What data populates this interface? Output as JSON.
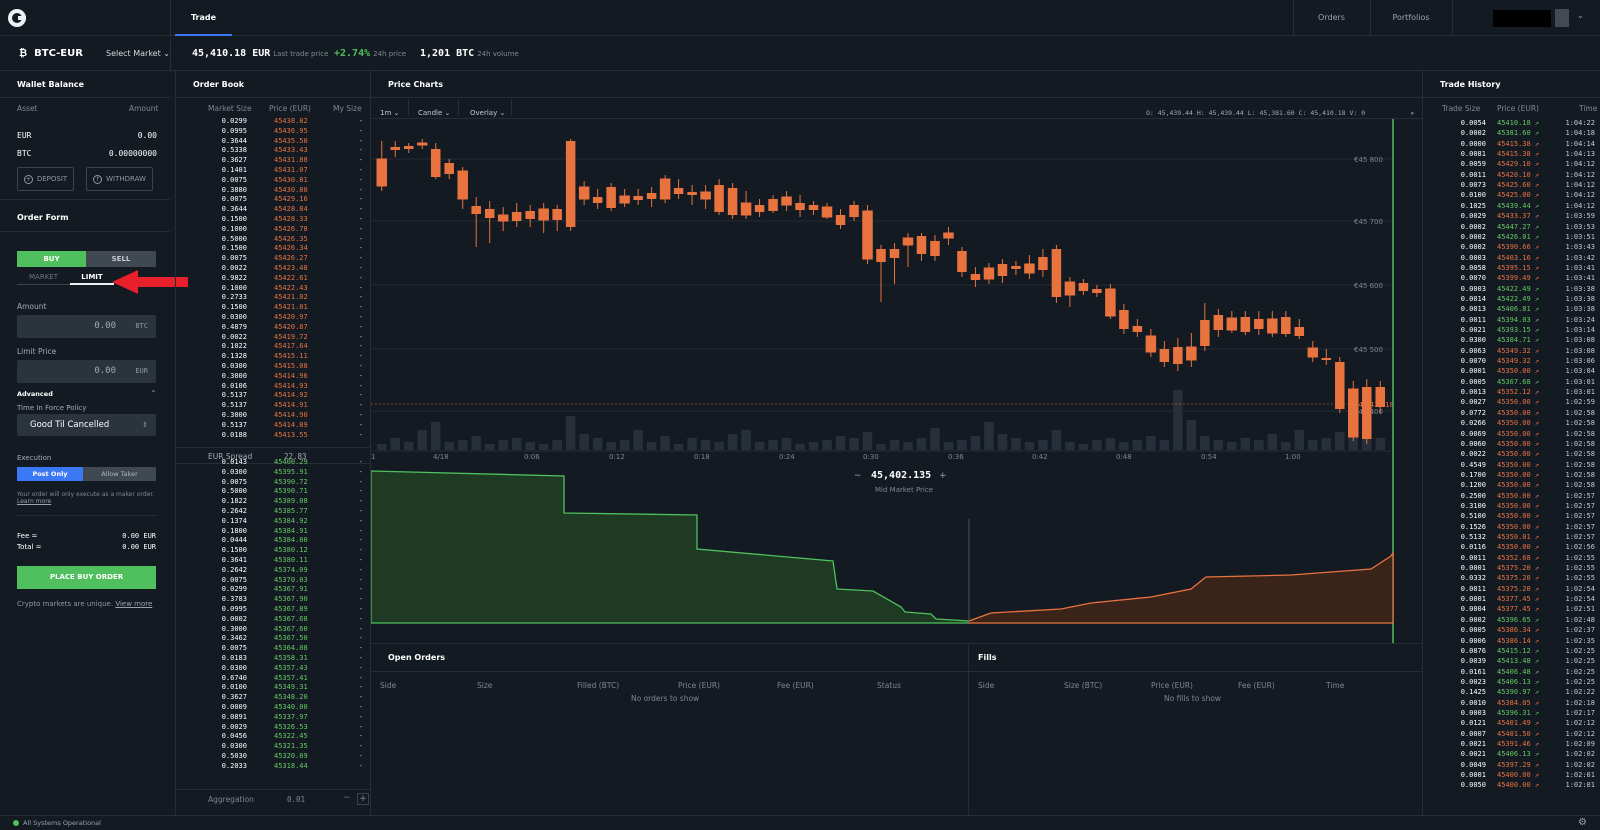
{
  "nav": {
    "tab": "Trade",
    "orders": "Orders",
    "portfolios": "Portfolios"
  },
  "market": {
    "pair": "BTC-EUR",
    "select": "Select Market",
    "last_price": "45,410.18 EUR",
    "last_price_label": "Last trade price",
    "change": "+2.74%",
    "change_label": "24h price",
    "volume": "1,201 BTC",
    "volume_label": "24h volume"
  },
  "wallet": {
    "title": "Wallet Balance",
    "asset_hdr": "Asset",
    "amount_hdr": "Amount",
    "rows": [
      {
        "asset": "EUR",
        "amount": "0.00"
      },
      {
        "asset": "BTC",
        "amount": "0.00000000"
      }
    ],
    "deposit": "DEPOSIT",
    "withdraw": "WITHDRAW"
  },
  "order_form": {
    "title": "Order Form",
    "buy": "BUY",
    "sell": "SELL",
    "market": "MARKET",
    "limit": "LIMIT",
    "amount_label": "Amount",
    "amount_value": "0.00",
    "amount_unit": "BTC",
    "limit_label": "Limit Price",
    "limit_value": "0.00",
    "limit_unit": "EUR",
    "advanced": "Advanced",
    "tif_label": "Time In Force Policy",
    "tif_value": "Good Til Cancelled",
    "execution_label": "Execution",
    "post_only": "Post Only",
    "allow_taker": "Allow Taker",
    "note": "Your order will only execute as a maker order.",
    "learn_more": "Learn more",
    "fee_label": "Fee =",
    "fee_value": "0.00 EUR",
    "total_label": "Total =",
    "total_value": "0.00 EUR",
    "place": "PLACE BUY ORDER",
    "unique": "Crypto markets are unique.",
    "view_more": "View more"
  },
  "order_book": {
    "title": "Order Book",
    "hdr_size": "Market Size",
    "hdr_price": "Price (EUR)",
    "hdr_my": "My Size",
    "spread_label": "EUR Spread",
    "spread_value": "22.83",
    "aggregation_label": "Aggregation",
    "aggregation_value": "0.01",
    "asks": [
      [
        "0.0299",
        "45438.82"
      ],
      [
        "0.0995",
        "45436.95"
      ],
      [
        "0.3644",
        "45435.50"
      ],
      [
        "0.5338",
        "45433.43"
      ],
      [
        "0.3627",
        "45431.88"
      ],
      [
        "0.1401",
        "45431.07"
      ],
      [
        "0.0075",
        "45430.81"
      ],
      [
        "0.3880",
        "45430.80"
      ],
      [
        "0.0075",
        "45429.16"
      ],
      [
        "0.3644",
        "45428.84"
      ],
      [
        "0.1500",
        "45428.33"
      ],
      [
        "0.1000",
        "45426.78"
      ],
      [
        "0.5000",
        "45426.35"
      ],
      [
        "0.1500",
        "45426.34"
      ],
      [
        "0.0075",
        "45426.27"
      ],
      [
        "0.0022",
        "45423.48"
      ],
      [
        "0.9822",
        "45422.61"
      ],
      [
        "0.1000",
        "45422.43"
      ],
      [
        "0.2733",
        "45421.02"
      ],
      [
        "0.1500",
        "45421.01"
      ],
      [
        "0.0300",
        "45420.97"
      ],
      [
        "0.4879",
        "45420.87"
      ],
      [
        "0.0022",
        "45419.72"
      ],
      [
        "0.1022",
        "45417.64"
      ],
      [
        "0.1328",
        "45415.11"
      ],
      [
        "0.0300",
        "45415.08"
      ],
      [
        "0.3000",
        "45414.96"
      ],
      [
        "0.0106",
        "45414.93"
      ],
      [
        "0.5137",
        "45414.92"
      ],
      [
        "0.5137",
        "45414.91"
      ],
      [
        "0.3000",
        "45414.90"
      ],
      [
        "0.5137",
        "45414.89"
      ],
      [
        "0.0188",
        "45413.55"
      ]
    ],
    "bids": [
      [
        "0.0143",
        "45400.29"
      ],
      [
        "0.0300",
        "45395.91"
      ],
      [
        "0.0075",
        "45390.72"
      ],
      [
        "0.5000",
        "45390.71"
      ],
      [
        "0.1822",
        "45389.08"
      ],
      [
        "0.2642",
        "45385.77"
      ],
      [
        "0.1374",
        "45384.92"
      ],
      [
        "0.1800",
        "45384.91"
      ],
      [
        "0.0444",
        "45384.00"
      ],
      [
        "0.1500",
        "45380.12"
      ],
      [
        "0.3641",
        "45380.11"
      ],
      [
        "0.2642",
        "45374.09"
      ],
      [
        "0.0075",
        "45370.03"
      ],
      [
        "0.0299",
        "45367.91"
      ],
      [
        "0.3783",
        "45367.90"
      ],
      [
        "0.0995",
        "45367.89"
      ],
      [
        "0.0002",
        "45367.68"
      ],
      [
        "0.3000",
        "45367.60"
      ],
      [
        "0.3462",
        "45367.50"
      ],
      [
        "0.0075",
        "45364.08"
      ],
      [
        "0.0183",
        "45358.31"
      ],
      [
        "0.0300",
        "45357.43"
      ],
      [
        "0.6740",
        "45357.41"
      ],
      [
        "0.0100",
        "45349.31"
      ],
      [
        "0.3627",
        "45348.20"
      ],
      [
        "0.0009",
        "45340.00"
      ],
      [
        "0.0891",
        "45337.97"
      ],
      [
        "0.0029",
        "45326.53"
      ],
      [
        "0.0456",
        "45322.45"
      ],
      [
        "0.0300",
        "45321.35"
      ],
      [
        "0.5030",
        "45320.09"
      ],
      [
        "0.2033",
        "45318.44"
      ]
    ]
  },
  "charts": {
    "title": "Price Charts",
    "interval": "1m",
    "type": "Candle",
    "overlay": "Overlay",
    "ohlc": "O: 45,439.44  H: 45,439.44  L: 45,381.60  C: 45,410.18  V: 0",
    "last_tag": "€45 410.18",
    "mid_price": "45,402.135",
    "mid_label": "Mid Market Price",
    "minus": "−",
    "plus": "+"
  },
  "chart_data": [
    {
      "type": "candlestick",
      "title": "Price Charts",
      "x": [
        "1",
        "4/18",
        "0:06",
        "0:12",
        "0:18",
        "0:24",
        "0:30",
        "0:36",
        "0:42",
        "0:48",
        "0:54",
        "1:00"
      ],
      "y_ticks": [
        "€45 400",
        "€45 500",
        "€45 600",
        "€45 700",
        "€45 800"
      ],
      "last": 45410.18
    },
    {
      "type": "area",
      "title": "Depth",
      "y_ticks": [
        "0",
        "20",
        "40",
        "60",
        "80"
      ],
      "series": [
        {
          "name": "bids",
          "color": "#4fc05d"
        },
        {
          "name": "asks",
          "color": "#e8733f"
        }
      ],
      "mid": 45402.135
    }
  ],
  "open_orders": {
    "title": "Open Orders",
    "cols": [
      "Side",
      "Size",
      "Filled (BTC)",
      "Price (EUR)",
      "Fee (EUR)",
      "Status"
    ],
    "empty": "No orders to show"
  },
  "fills": {
    "title": "Fills",
    "cols": [
      "Side",
      "Size (BTC)",
      "Price (EUR)",
      "Fee (EUR)",
      "Time"
    ],
    "empty": "No fills to show"
  },
  "trade_history": {
    "title": "Trade History",
    "hdr_size": "Trade Size",
    "hdr_price": "Price (EUR)",
    "hdr_time": "Time",
    "rows": [
      [
        "0.0054",
        "45410.18",
        "g",
        "1:04:22"
      ],
      [
        "0.0002",
        "45381.60",
        "g",
        "1:04:18"
      ],
      [
        "0.0000",
        "45415.38",
        "r",
        "1:04:14"
      ],
      [
        "0.0081",
        "45415.38",
        "r",
        "1:04:13"
      ],
      [
        "0.0059",
        "45429.10",
        "r",
        "1:04:12"
      ],
      [
        "0.0011",
        "45420.10",
        "r",
        "1:04:12"
      ],
      [
        "0.0073",
        "45425.60",
        "r",
        "1:04:12"
      ],
      [
        "0.0100",
        "45425.00",
        "r",
        "1:04:12"
      ],
      [
        "0.1025",
        "45439.44",
        "g",
        "1:04:12"
      ],
      [
        "0.0029",
        "45433.37",
        "r",
        "1:03:59"
      ],
      [
        "0.0002",
        "45447.27",
        "g",
        "1:03:53"
      ],
      [
        "0.0002",
        "45426.01",
        "g",
        "1:03:51"
      ],
      [
        "0.0002",
        "45390.66",
        "r",
        "1:03:43"
      ],
      [
        "0.0003",
        "45403.16",
        "r",
        "1:03:42"
      ],
      [
        "0.0058",
        "45395.15",
        "r",
        "1:03:41"
      ],
      [
        "0.0070",
        "45399.49",
        "r",
        "1:03:41"
      ],
      [
        "0.0003",
        "45422.49",
        "g",
        "1:03:38"
      ],
      [
        "0.0014",
        "45422.49",
        "g",
        "1:03:38"
      ],
      [
        "0.0013",
        "45406.81",
        "g",
        "1:03:38"
      ],
      [
        "0.0011",
        "45394.03",
        "g",
        "1:03:24"
      ],
      [
        "0.0021",
        "45393.15",
        "g",
        "1:03:14"
      ],
      [
        "0.0300",
        "45384.71",
        "g",
        "1:03:08"
      ],
      [
        "0.0063",
        "45349.32",
        "r",
        "1:03:08"
      ],
      [
        "0.0070",
        "45349.32",
        "r",
        "1:03:06"
      ],
      [
        "0.0001",
        "45350.00",
        "r",
        "1:03:04"
      ],
      [
        "0.0005",
        "45367.68",
        "g",
        "1:03:01"
      ],
      [
        "0.0013",
        "45352.12",
        "r",
        "1:03:01"
      ],
      [
        "0.0027",
        "45350.00",
        "r",
        "1:02:59"
      ],
      [
        "0.0772",
        "45350.00",
        "r",
        "1:02:58"
      ],
      [
        "0.0266",
        "45350.00",
        "r",
        "1:02:58"
      ],
      [
        "0.0069",
        "45350.00",
        "r",
        "1:02:58"
      ],
      [
        "0.0060",
        "45350.00",
        "r",
        "1:02:58"
      ],
      [
        "0.0022",
        "45350.00",
        "r",
        "1:02:58"
      ],
      [
        "0.4549",
        "45350.00",
        "r",
        "1:02:58"
      ],
      [
        "0.1700",
        "45350.00",
        "r",
        "1:02:58"
      ],
      [
        "0.1200",
        "45350.00",
        "r",
        "1:02:58"
      ],
      [
        "0.2500",
        "45350.00",
        "r",
        "1:02:57"
      ],
      [
        "0.3100",
        "45350.00",
        "r",
        "1:02:57"
      ],
      [
        "0.5100",
        "45350.00",
        "r",
        "1:02:57"
      ],
      [
        "0.1526",
        "45350.00",
        "r",
        "1:02:57"
      ],
      [
        "0.5132",
        "45350.01",
        "r",
        "1:02:57"
      ],
      [
        "0.0116",
        "45350.00",
        "r",
        "1:02:56"
      ],
      [
        "0.0011",
        "45352.68",
        "r",
        "1:02:55"
      ],
      [
        "0.0001",
        "45375.20",
        "r",
        "1:02:55"
      ],
      [
        "0.0332",
        "45375.20",
        "r",
        "1:02:55"
      ],
      [
        "0.0011",
        "45375.20",
        "r",
        "1:02:54"
      ],
      [
        "0.0001",
        "45377.45",
        "r",
        "1:02:54"
      ],
      [
        "0.0004",
        "45377.45",
        "r",
        "1:02:51"
      ],
      [
        "0.0002",
        "45396.65",
        "g",
        "1:02:48"
      ],
      [
        "0.0005",
        "45386.34",
        "r",
        "1:02:37"
      ],
      [
        "0.0006",
        "45386.14",
        "r",
        "1:02:35"
      ],
      [
        "0.0876",
        "45415.12",
        "g",
        "1:02:25"
      ],
      [
        "0.0039",
        "45413.48",
        "g",
        "1:02:25"
      ],
      [
        "0.0161",
        "45406.48",
        "g",
        "1:02:25"
      ],
      [
        "0.0023",
        "45406.13",
        "g",
        "1:02:25"
      ],
      [
        "0.1425",
        "45390.97",
        "g",
        "1:02:22"
      ],
      [
        "0.0010",
        "45384.05",
        "r",
        "1:02:18"
      ],
      [
        "0.0003",
        "45396.31",
        "g",
        "1:02:17"
      ],
      [
        "0.0121",
        "45401.49",
        "r",
        "1:02:12"
      ],
      [
        "0.0007",
        "45401.50",
        "r",
        "1:02:12"
      ],
      [
        "0.0021",
        "45391.46",
        "r",
        "1:02:09"
      ],
      [
        "0.0021",
        "45406.13",
        "g",
        "1:02:02"
      ],
      [
        "0.0049",
        "45397.29",
        "r",
        "1:02:02"
      ],
      [
        "0.0001",
        "45400.00",
        "r",
        "1:02:01"
      ],
      [
        "0.0050",
        "45400.00",
        "r",
        "1:02:01"
      ]
    ]
  },
  "status": {
    "text": "All Systems Operational"
  },
  "colors": {
    "green": "#4fc05d",
    "red": "#e8733f",
    "blue": "#3a78f5",
    "bg": "#141a22"
  }
}
